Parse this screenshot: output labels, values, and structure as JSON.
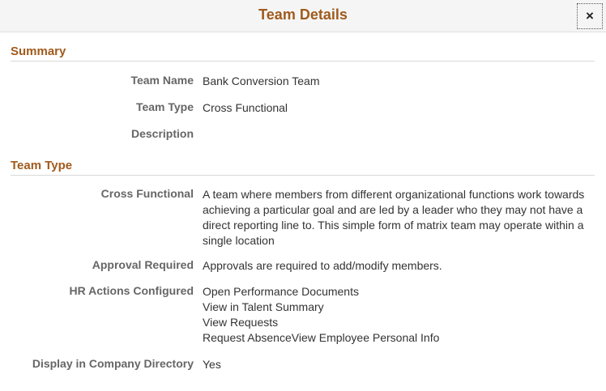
{
  "modal": {
    "title": "Team Details",
    "close_label": "×"
  },
  "summary": {
    "heading": "Summary",
    "fields": [
      {
        "label": "Team Name",
        "value": "Bank Conversion Team"
      },
      {
        "label": "Team Type",
        "value": "Cross Functional"
      },
      {
        "label": "Description",
        "value": ""
      }
    ]
  },
  "team_type": {
    "heading": "Team Type",
    "fields": [
      {
        "label": "Cross Functional",
        "value": "A team where members from different organizational functions work towards achieving a particular goal and are led by a leader who they may not have a direct reporting line to. This simple form of matrix team may operate within a single location"
      },
      {
        "label": "Approval Required",
        "value": "Approvals are required to add/modify members."
      },
      {
        "label": "HR Actions Configured",
        "lines": [
          "Open Performance Documents",
          "View in Talent Summary",
          "View Requests",
          "Request AbsenceView Employee Personal Info"
        ]
      },
      {
        "label": "Display in Company Directory",
        "value": "Yes"
      }
    ]
  }
}
